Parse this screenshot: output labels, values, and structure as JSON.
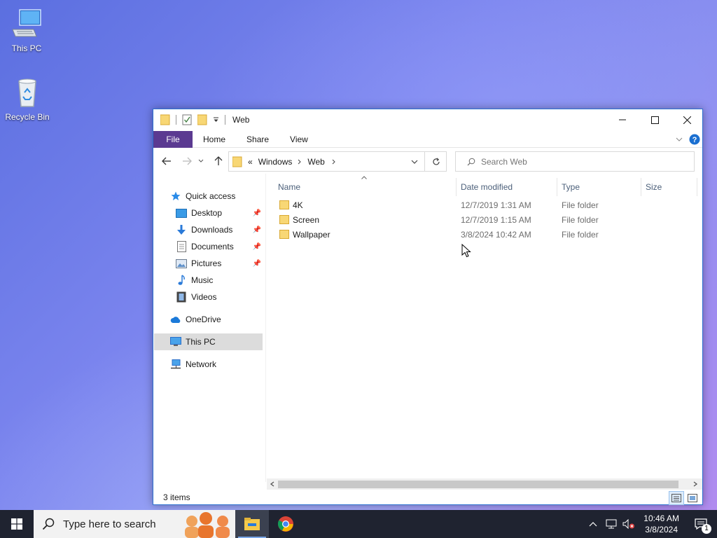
{
  "desktop": {
    "icons": [
      {
        "label": "This PC"
      },
      {
        "label": "Recycle Bin"
      }
    ]
  },
  "window": {
    "title": "Web",
    "ribbon_tabs": [
      "File",
      "Home",
      "Share",
      "View"
    ],
    "address": {
      "overflow": "«",
      "crumbs": [
        "Windows",
        "Web"
      ]
    },
    "search_placeholder": "Search Web",
    "nav": {
      "quick_access": "Quick access",
      "quick_items": [
        "Desktop",
        "Downloads",
        "Documents",
        "Pictures",
        "Music",
        "Videos"
      ],
      "onedrive": "OneDrive",
      "this_pc": "This PC",
      "network": "Network"
    },
    "columns": {
      "name": "Name",
      "date": "Date modified",
      "type": "Type",
      "size": "Size"
    },
    "files": [
      {
        "name": "4K",
        "date": "12/7/2019 1:31 AM",
        "type": "File folder"
      },
      {
        "name": "Screen",
        "date": "12/7/2019 1:15 AM",
        "type": "File folder"
      },
      {
        "name": "Wallpaper",
        "date": "3/8/2024 10:42 AM",
        "type": "File folder"
      }
    ],
    "status": "3 items"
  },
  "taskbar": {
    "search_placeholder": "Type here to search",
    "time": "10:46 AM",
    "date": "3/8/2024",
    "notification_count": "1"
  },
  "colors": {
    "file_tab": "#5b3a91",
    "accent": "#0078d7",
    "folder": "#f4c94a",
    "taskbar": "#1f2330"
  }
}
